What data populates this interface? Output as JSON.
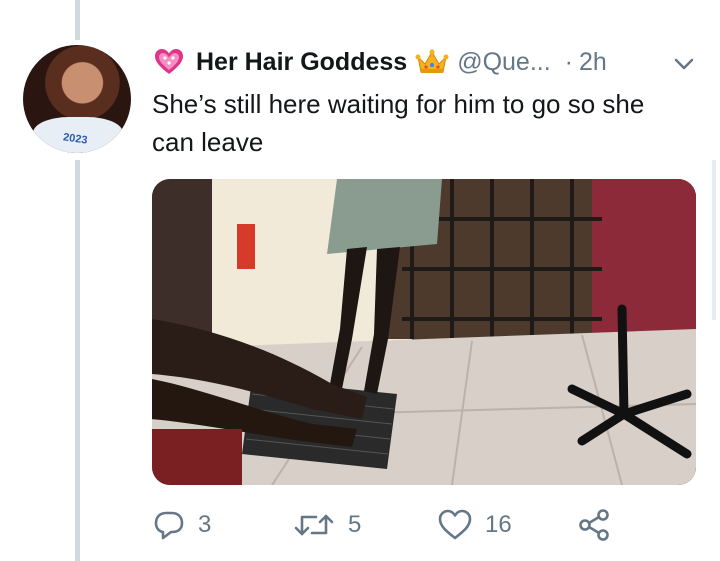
{
  "tweet": {
    "display_name": "Her Hair Goddess",
    "handle": "@Que...",
    "separator": "·",
    "timestamp": "2h",
    "text": "She’s still here waiting for him to go so she can leave",
    "icons": {
      "name_prefix": "heart-emoji-icon",
      "name_suffix": "crown-emoji-icon",
      "menu": "chevron-down-icon"
    },
    "avatar_text": "2023"
  },
  "actions": {
    "reply_count": "3",
    "retweet_count": "5",
    "like_count": "16",
    "icons": [
      "reply-icon",
      "retweet-icon",
      "like-icon",
      "share-icon"
    ]
  },
  "colors": {
    "text_primary": "#14171a",
    "text_secondary": "#657786",
    "thread_line": "#cfd9de",
    "heart_emoji": "#e0338a"
  }
}
